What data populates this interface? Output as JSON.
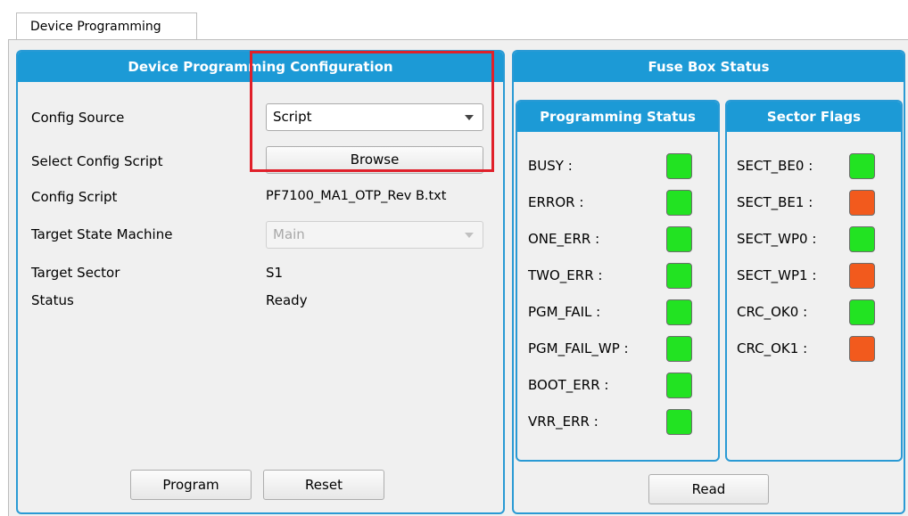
{
  "tab": {
    "label": "Device Programming"
  },
  "config": {
    "title": "Device Programming Configuration",
    "config_source": {
      "label": "Config Source",
      "value": "Script"
    },
    "select_script": {
      "label": "Select Config Script",
      "button": "Browse"
    },
    "config_script": {
      "label": "Config Script",
      "value": "PF7100_MA1_OTP_Rev B.txt"
    },
    "target_state_machine": {
      "label": "Target State Machine",
      "value": "Main"
    },
    "target_sector": {
      "label": "Target Sector",
      "value": "S1"
    },
    "status": {
      "label": "Status",
      "value": "Ready"
    },
    "program_button": "Program",
    "reset_button": "Reset"
  },
  "fuse_box": {
    "title": "Fuse Box Status",
    "programming_status": {
      "title": "Programming Status",
      "items": [
        {
          "label": "BUSY :",
          "state": "ok"
        },
        {
          "label": "ERROR :",
          "state": "ok"
        },
        {
          "label": "ONE_ERR :",
          "state": "ok"
        },
        {
          "label": "TWO_ERR :",
          "state": "ok"
        },
        {
          "label": "PGM_FAIL :",
          "state": "ok"
        },
        {
          "label": "PGM_FAIL_WP :",
          "state": "ok"
        },
        {
          "label": "BOOT_ERR :",
          "state": "ok"
        },
        {
          "label": "VRR_ERR :",
          "state": "ok"
        }
      ]
    },
    "sector_flags": {
      "title": "Sector Flags",
      "items": [
        {
          "label": "SECT_BE0 :",
          "state": "ok"
        },
        {
          "label": "SECT_BE1 :",
          "state": "set"
        },
        {
          "label": "SECT_WP0 :",
          "state": "ok"
        },
        {
          "label": "SECT_WP1 :",
          "state": "set"
        },
        {
          "label": "CRC_OK0 :",
          "state": "ok"
        },
        {
          "label": "CRC_OK1 :",
          "state": "set"
        }
      ]
    },
    "read_button": "Read"
  },
  "colors": {
    "header_blue": "#1c9ad6",
    "led_green": "#22e322",
    "led_orange": "#f25a1d",
    "highlight_red": "#e0202a"
  }
}
